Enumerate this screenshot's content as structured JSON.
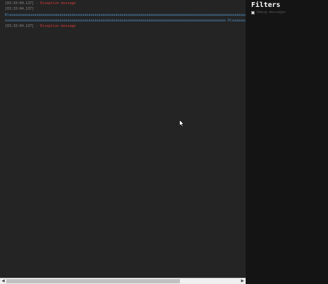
{
  "log": {
    "lines": [
      {
        "timestamp": "[03:33:04.137]",
        "message": "- Exception message",
        "kind": "error"
      },
      {
        "timestamp": "[03:33:04.137]",
        "message": "",
        "kind": "info"
      },
      {
        "timestamp": "",
        "message": "Blaaaaaaaaaaaaaaaaaaaaaaaaaaaaaaaaaaaaaaaaaaaaaaaaaaaaaaaaaaaaaaaaaaaaaaaaaaaaaaaaaaaaaaaaaaaaaaaaaaaaaaaaaaaaaaaaaaaaaaaaaaaaaaaaaaaaaaaa",
        "kind": "blue"
      },
      {
        "timestamp": "",
        "message": "aaaaaaaaaaaaaaaaaaaaaaaaaaaaaaaaaaaaaaaaaaaaaaaaaaaaaaaaaaaaaaaaaaaaaaaaaaaaaaaaaaaaaaaaaaaaaaaaaaaaaaaaaa Blaaaaaaaaaaaaaaaaaaaaaaaaaaaaaaaaaa",
        "kind": "blue"
      },
      {
        "timestamp": "[03:33:04.137]",
        "message": "- Exception message",
        "kind": "error"
      }
    ]
  },
  "filters": {
    "title": "Filters",
    "debug_label": "Debug messages",
    "debug_checked": false
  },
  "colors": {
    "log_background": "#242424",
    "sidebar_background": "#141414",
    "error_text": "#d33a3a",
    "link_text": "#4b86b4"
  }
}
